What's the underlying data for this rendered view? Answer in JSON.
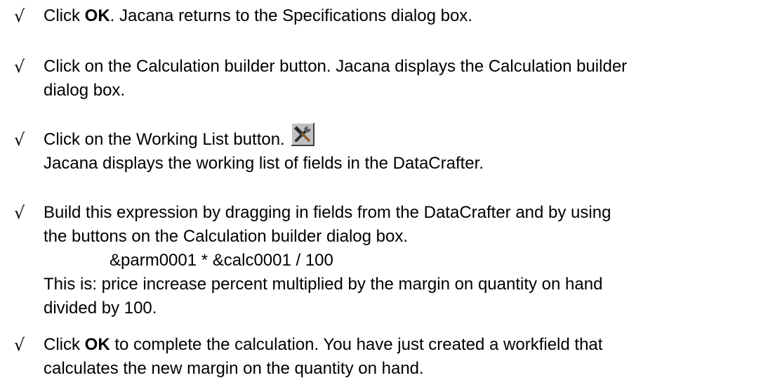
{
  "bullet_symbol": "√",
  "steps": [
    {
      "line1_pre": "Click ",
      "line1_bold": "OK",
      "line1_post": ". Jacana returns to the Specifications dialog box."
    },
    {
      "line1": "Click on the Calculation builder button. Jacana displays the Calculation builder",
      "line2": "dialog box."
    },
    {
      "line1": "Click on the Working List button.",
      "icon": "hammer-wrench-icon",
      "line2": "Jacana displays the working list of fields in the DataCrafter."
    },
    {
      "line1": "Build this expression by dragging in fields from the DataCrafter and by using",
      "line2": "the buttons on the Calculation builder dialog box.",
      "formula": "&parm0001 * &calc0001 / 100",
      "line3": "This is: price increase percent multiplied by the margin on quantity on hand",
      "line4": "divided by 100."
    },
    {
      "line1_pre": "Click ",
      "line1_bold": "OK",
      "line1_post": " to complete the calculation. You have just created a workfield that",
      "line2": "calculates the new margin on the quantity on hand."
    }
  ]
}
